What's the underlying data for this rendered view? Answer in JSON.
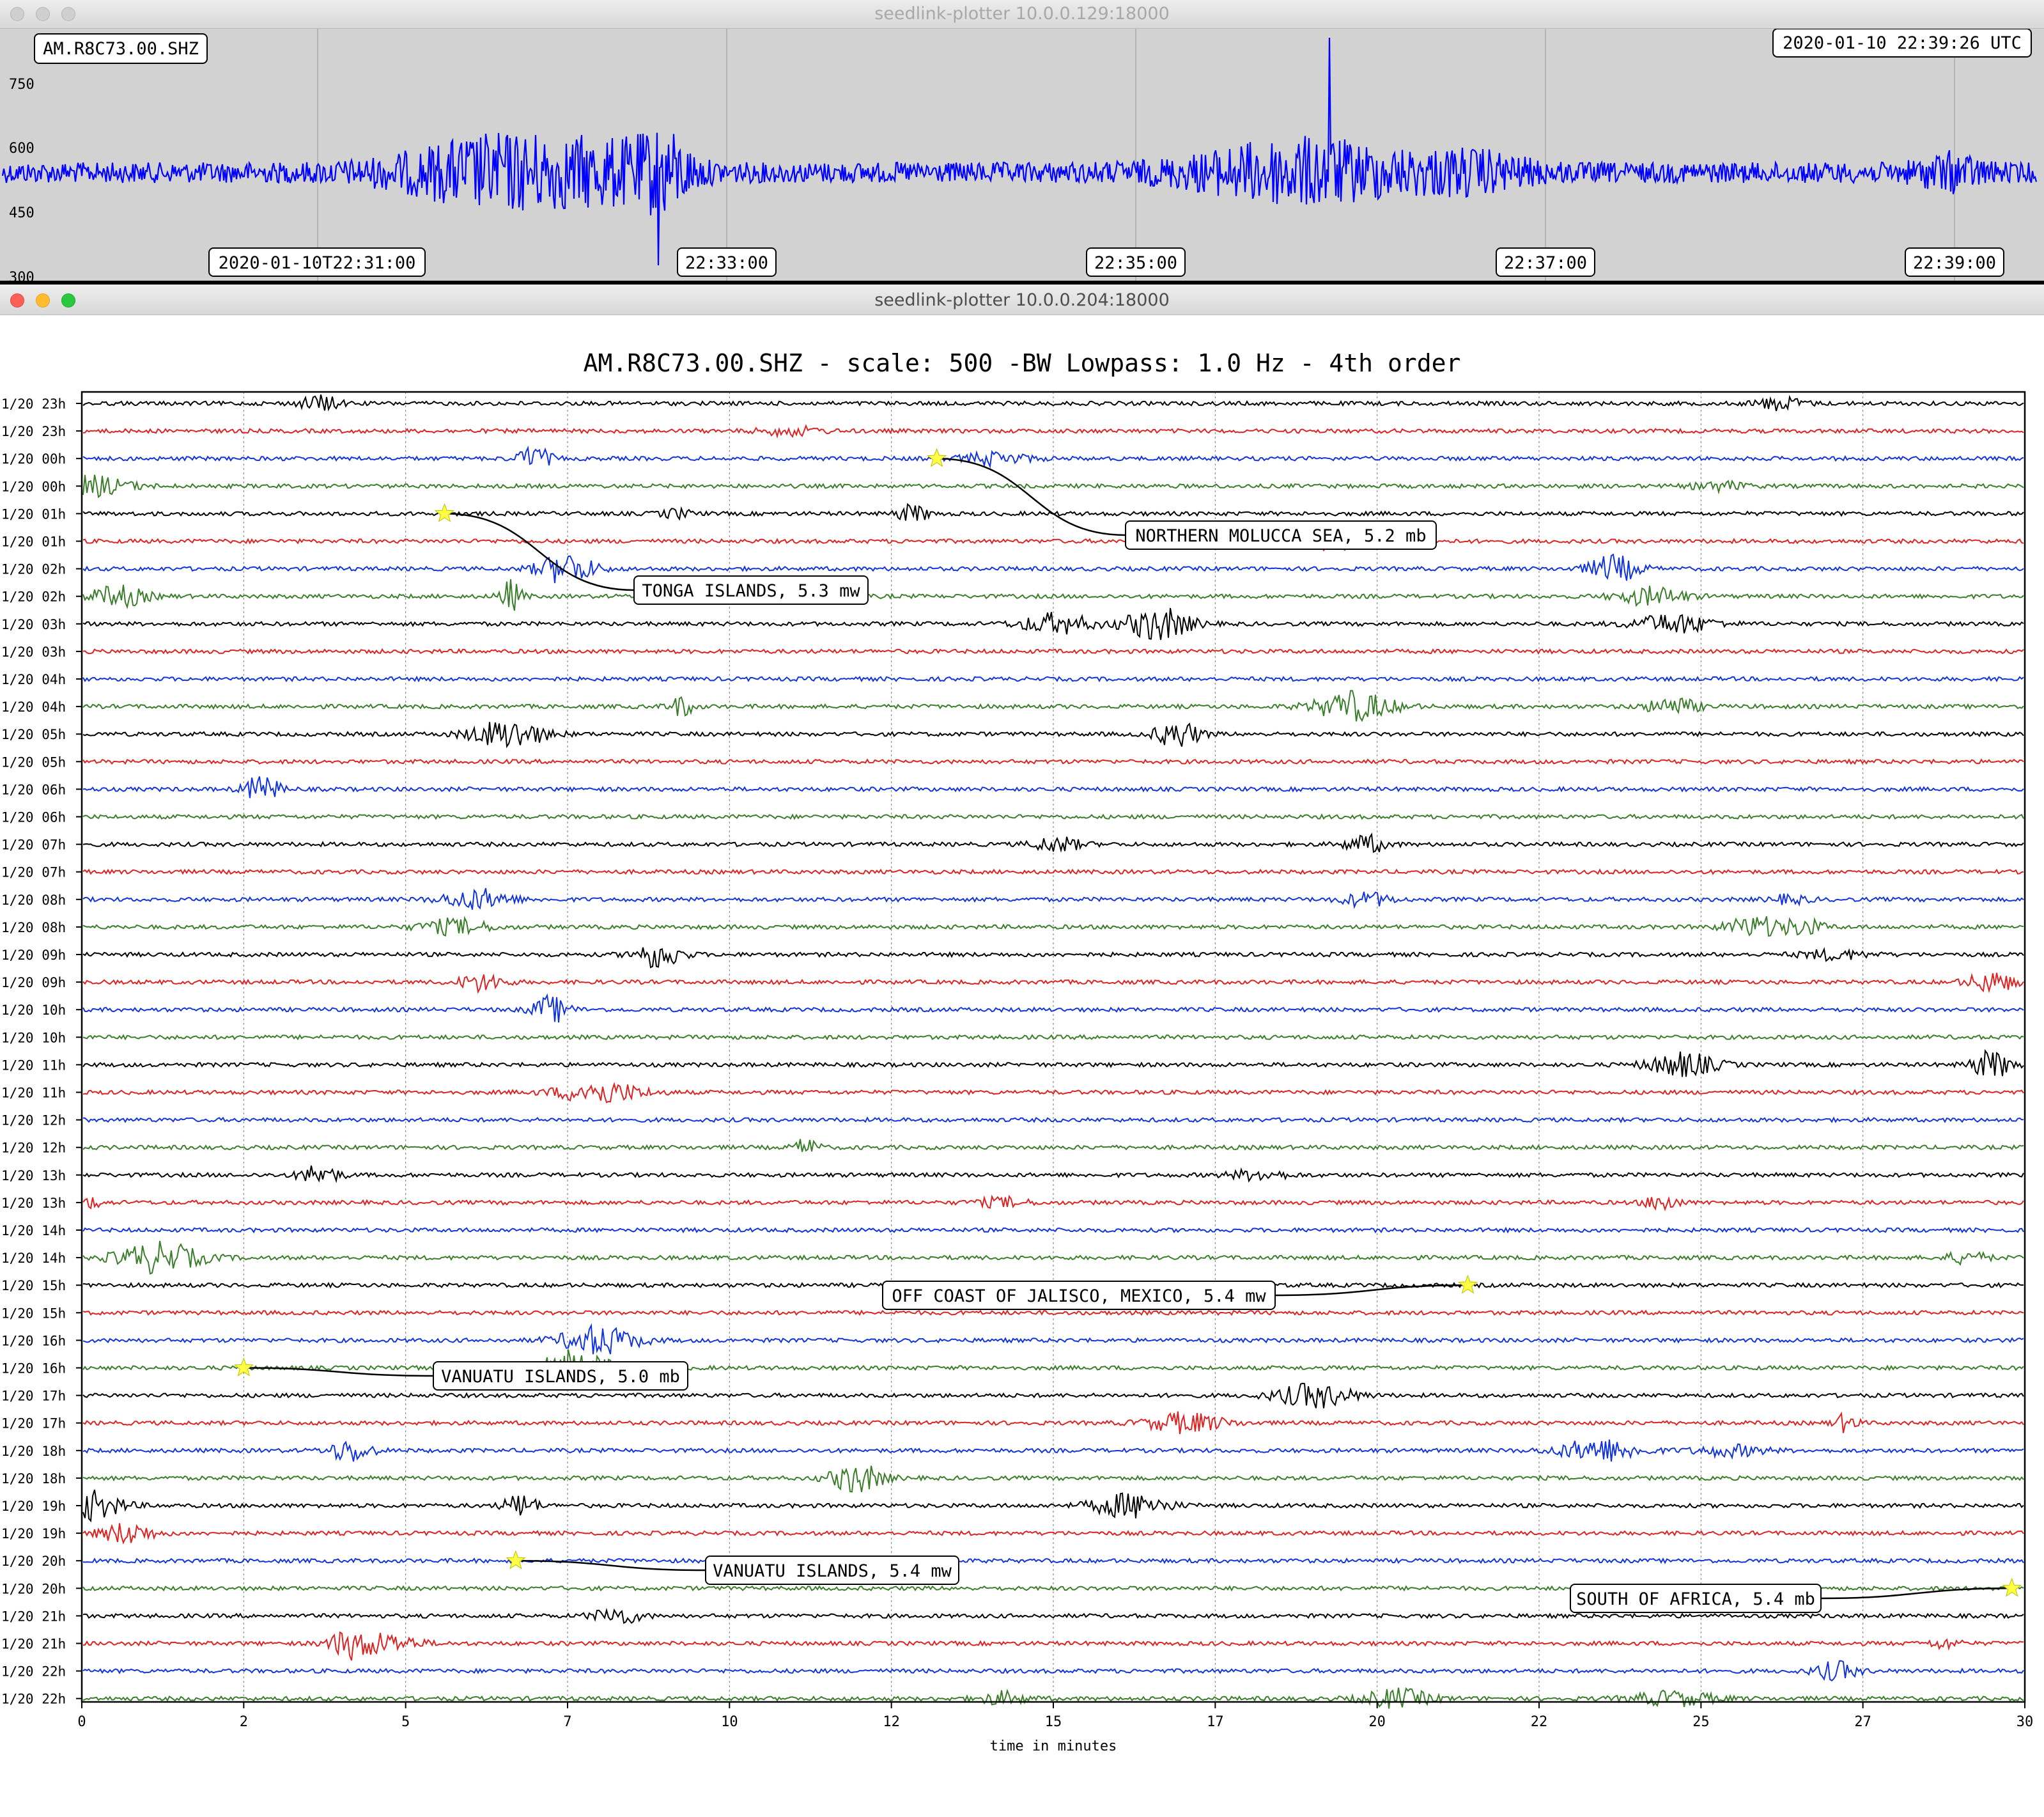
{
  "top_window": {
    "title": "seedlink-plotter 10.0.0.129:18000",
    "station_label": "AM.R8C73.00.SHZ",
    "timestamp_label": "2020-01-10 22:39:26 UTC",
    "y_ticks": [
      "750",
      "600",
      "450",
      "300"
    ],
    "time_labels": [
      "2020-01-10T22:31:00",
      "22:33:00",
      "22:35:00",
      "22:37:00",
      "22:39:00"
    ],
    "trace_color": "#0000ff"
  },
  "bottom_window": {
    "title": "seedlink-plotter 10.0.0.204:18000",
    "plot_title": "AM.R8C73.00.SHZ - scale: 500 -BW Lowpass: 1.0 Hz - 4th order",
    "x_axis_label": "time in minutes",
    "x_ticks": [
      "0",
      "2",
      "5",
      "7",
      "10",
      "12",
      "15",
      "17",
      "20",
      "22",
      "25",
      "27",
      "30"
    ],
    "row_labels": [
      "1/20 23h",
      "1/20 23h",
      "1/20 00h",
      "1/20 00h",
      "1/20 01h",
      "1/20 01h",
      "1/20 02h",
      "1/20 02h",
      "1/20 03h",
      "1/20 03h",
      "1/20 04h",
      "1/20 04h",
      "1/20 05h",
      "1/20 05h",
      "1/20 06h",
      "1/20 06h",
      "1/20 07h",
      "1/20 07h",
      "1/20 08h",
      "1/20 08h",
      "1/20 09h",
      "1/20 09h",
      "1/20 10h",
      "1/20 10h",
      "1/20 11h",
      "1/20 11h",
      "1/20 12h",
      "1/20 12h",
      "1/20 13h",
      "1/20 13h",
      "1/20 14h",
      "1/20 14h",
      "1/20 15h",
      "1/20 15h",
      "1/20 16h",
      "1/20 16h",
      "1/20 17h",
      "1/20 17h",
      "1/20 18h",
      "1/20 18h",
      "1/20 19h",
      "1/20 19h",
      "1/20 20h",
      "1/20 20h",
      "1/20 21h",
      "1/20 21h",
      "1/20 22h",
      "1/20 22h"
    ],
    "trace_colors": [
      "#000000",
      "#dd2222",
      "#1133dd",
      "#3a7d2a"
    ],
    "star_color": "#ffff44",
    "events": [
      {
        "label": "NORTHERN MOLUCCA SEA, 5.2 mb",
        "row": 2,
        "minute": 13.2
      },
      {
        "label": "TONGA ISLANDS, 5.3 mw",
        "row": 4,
        "minute": 5.6
      },
      {
        "label": "OFF COAST OF JALISCO, MEXICO, 5.4 mw",
        "row": 32,
        "minute": 21.4
      },
      {
        "label": "VANUATU ISLANDS, 5.0 mb",
        "row": 35,
        "minute": 2.5
      },
      {
        "label": "VANUATU ISLANDS, 5.4 mw",
        "row": 42,
        "minute": 6.7
      },
      {
        "label": "SOUTH OF AFRICA, 5.4 mb",
        "row": 43,
        "minute": 29.8
      }
    ]
  }
}
